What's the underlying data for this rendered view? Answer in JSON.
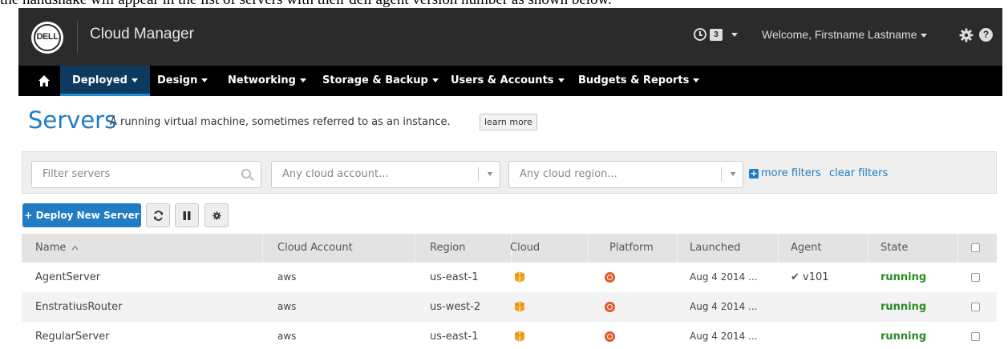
{
  "caption": "the handshake will appear in the list of servers with their dell agent version number as shown below.",
  "app": {
    "logo_text": "DELL",
    "title": "Cloud Manager",
    "notification_count": "3",
    "welcome": "Welcome, Firstname Lastname"
  },
  "nav": {
    "items": [
      {
        "label": "Deployed"
      },
      {
        "label": "Design"
      },
      {
        "label": "Networking"
      },
      {
        "label": "Storage & Backup"
      },
      {
        "label": "Users & Accounts"
      },
      {
        "label": "Budgets & Reports"
      }
    ],
    "active": "Deployed"
  },
  "page": {
    "title": "Servers",
    "description": "A running virtual machine, sometimes referred to as an instance.",
    "learn_more": "learn more"
  },
  "filters": {
    "search_placeholder": "Filter servers",
    "account_placeholder": "Any cloud account...",
    "region_placeholder": "Any cloud region...",
    "more_filters": "more filters",
    "clear_filters": "clear filters"
  },
  "toolbar": {
    "deploy_label": "+ Deploy New Server"
  },
  "table": {
    "columns": [
      "Name",
      "Cloud Account",
      "Region",
      "Cloud",
      "Platform",
      "Launched",
      "Agent",
      "State"
    ],
    "sort_indicator": "^",
    "rows": [
      {
        "name": "AgentServer",
        "account": "aws",
        "region": "us-east-1",
        "cloud": "aws-icon",
        "platform": "ubuntu-icon",
        "launched": "Aug 4 2014 ...",
        "agent": "v101",
        "state": "running"
      },
      {
        "name": "EnstratiusRouter",
        "account": "aws",
        "region": "us-west-2",
        "cloud": "aws-icon",
        "platform": "ubuntu-icon",
        "launched": "Aug 4 2014 ...",
        "agent": "",
        "state": "running"
      },
      {
        "name": "RegularServer",
        "account": "aws",
        "region": "us-east-1",
        "cloud": "aws-icon",
        "platform": "ubuntu-icon",
        "launched": "Aug 4 2014 ...",
        "agent": "",
        "state": "running"
      }
    ]
  },
  "colors": {
    "topbar": "#2b2b2b",
    "navbar": "#000000",
    "accent": "#1f7cc5",
    "running": "#2d8a25",
    "aws": "#f0a21d",
    "platform": "#e2572a"
  }
}
